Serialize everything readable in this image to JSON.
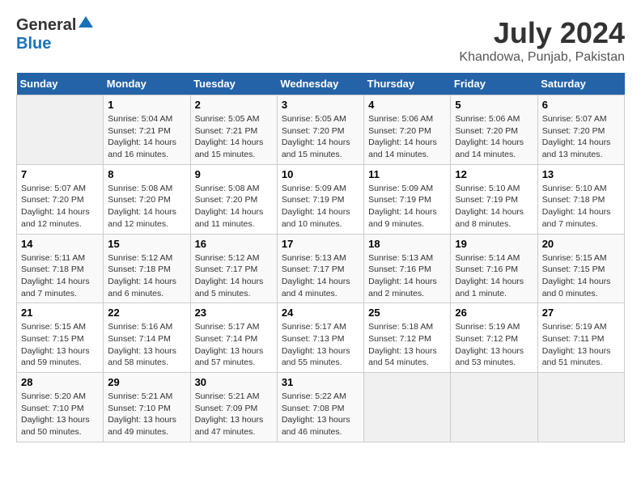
{
  "header": {
    "logo_general": "General",
    "logo_blue": "Blue",
    "month_year": "July 2024",
    "location": "Khandowa, Punjab, Pakistan"
  },
  "days_of_week": [
    "Sunday",
    "Monday",
    "Tuesday",
    "Wednesday",
    "Thursday",
    "Friday",
    "Saturday"
  ],
  "weeks": [
    [
      {
        "day": "",
        "info": ""
      },
      {
        "day": "1",
        "info": "Sunrise: 5:04 AM\nSunset: 7:21 PM\nDaylight: 14 hours\nand 16 minutes."
      },
      {
        "day": "2",
        "info": "Sunrise: 5:05 AM\nSunset: 7:21 PM\nDaylight: 14 hours\nand 15 minutes."
      },
      {
        "day": "3",
        "info": "Sunrise: 5:05 AM\nSunset: 7:20 PM\nDaylight: 14 hours\nand 15 minutes."
      },
      {
        "day": "4",
        "info": "Sunrise: 5:06 AM\nSunset: 7:20 PM\nDaylight: 14 hours\nand 14 minutes."
      },
      {
        "day": "5",
        "info": "Sunrise: 5:06 AM\nSunset: 7:20 PM\nDaylight: 14 hours\nand 14 minutes."
      },
      {
        "day": "6",
        "info": "Sunrise: 5:07 AM\nSunset: 7:20 PM\nDaylight: 14 hours\nand 13 minutes."
      }
    ],
    [
      {
        "day": "7",
        "info": "Sunrise: 5:07 AM\nSunset: 7:20 PM\nDaylight: 14 hours\nand 12 minutes."
      },
      {
        "day": "8",
        "info": "Sunrise: 5:08 AM\nSunset: 7:20 PM\nDaylight: 14 hours\nand 12 minutes."
      },
      {
        "day": "9",
        "info": "Sunrise: 5:08 AM\nSunset: 7:20 PM\nDaylight: 14 hours\nand 11 minutes."
      },
      {
        "day": "10",
        "info": "Sunrise: 5:09 AM\nSunset: 7:19 PM\nDaylight: 14 hours\nand 10 minutes."
      },
      {
        "day": "11",
        "info": "Sunrise: 5:09 AM\nSunset: 7:19 PM\nDaylight: 14 hours\nand 9 minutes."
      },
      {
        "day": "12",
        "info": "Sunrise: 5:10 AM\nSunset: 7:19 PM\nDaylight: 14 hours\nand 8 minutes."
      },
      {
        "day": "13",
        "info": "Sunrise: 5:10 AM\nSunset: 7:18 PM\nDaylight: 14 hours\nand 7 minutes."
      }
    ],
    [
      {
        "day": "14",
        "info": "Sunrise: 5:11 AM\nSunset: 7:18 PM\nDaylight: 14 hours\nand 7 minutes."
      },
      {
        "day": "15",
        "info": "Sunrise: 5:12 AM\nSunset: 7:18 PM\nDaylight: 14 hours\nand 6 minutes."
      },
      {
        "day": "16",
        "info": "Sunrise: 5:12 AM\nSunset: 7:17 PM\nDaylight: 14 hours\nand 5 minutes."
      },
      {
        "day": "17",
        "info": "Sunrise: 5:13 AM\nSunset: 7:17 PM\nDaylight: 14 hours\nand 4 minutes."
      },
      {
        "day": "18",
        "info": "Sunrise: 5:13 AM\nSunset: 7:16 PM\nDaylight: 14 hours\nand 2 minutes."
      },
      {
        "day": "19",
        "info": "Sunrise: 5:14 AM\nSunset: 7:16 PM\nDaylight: 14 hours\nand 1 minute."
      },
      {
        "day": "20",
        "info": "Sunrise: 5:15 AM\nSunset: 7:15 PM\nDaylight: 14 hours\nand 0 minutes."
      }
    ],
    [
      {
        "day": "21",
        "info": "Sunrise: 5:15 AM\nSunset: 7:15 PM\nDaylight: 13 hours\nand 59 minutes."
      },
      {
        "day": "22",
        "info": "Sunrise: 5:16 AM\nSunset: 7:14 PM\nDaylight: 13 hours\nand 58 minutes."
      },
      {
        "day": "23",
        "info": "Sunrise: 5:17 AM\nSunset: 7:14 PM\nDaylight: 13 hours\nand 57 minutes."
      },
      {
        "day": "24",
        "info": "Sunrise: 5:17 AM\nSunset: 7:13 PM\nDaylight: 13 hours\nand 55 minutes."
      },
      {
        "day": "25",
        "info": "Sunrise: 5:18 AM\nSunset: 7:12 PM\nDaylight: 13 hours\nand 54 minutes."
      },
      {
        "day": "26",
        "info": "Sunrise: 5:19 AM\nSunset: 7:12 PM\nDaylight: 13 hours\nand 53 minutes."
      },
      {
        "day": "27",
        "info": "Sunrise: 5:19 AM\nSunset: 7:11 PM\nDaylight: 13 hours\nand 51 minutes."
      }
    ],
    [
      {
        "day": "28",
        "info": "Sunrise: 5:20 AM\nSunset: 7:10 PM\nDaylight: 13 hours\nand 50 minutes."
      },
      {
        "day": "29",
        "info": "Sunrise: 5:21 AM\nSunset: 7:10 PM\nDaylight: 13 hours\nand 49 minutes."
      },
      {
        "day": "30",
        "info": "Sunrise: 5:21 AM\nSunset: 7:09 PM\nDaylight: 13 hours\nand 47 minutes."
      },
      {
        "day": "31",
        "info": "Sunrise: 5:22 AM\nSunset: 7:08 PM\nDaylight: 13 hours\nand 46 minutes."
      },
      {
        "day": "",
        "info": ""
      },
      {
        "day": "",
        "info": ""
      },
      {
        "day": "",
        "info": ""
      }
    ]
  ]
}
